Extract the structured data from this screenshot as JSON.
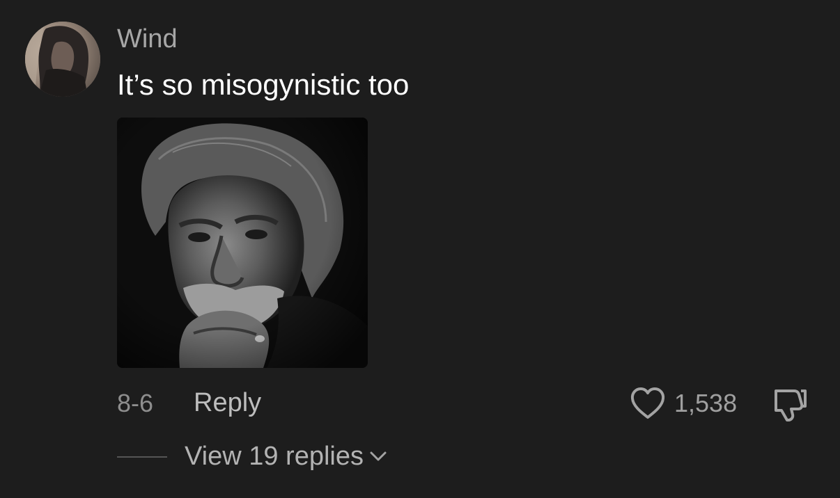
{
  "comment": {
    "avatar_icon": "user-avatar",
    "username": "Wind",
    "text": "It’s so misogynistic too",
    "attached_image": "portrait-photo",
    "timestamp": "8-6",
    "reply_label": "Reply",
    "like_icon": "heart-icon",
    "like_count": "1,538",
    "dislike_icon": "thumbs-down-icon",
    "view_replies_label": "View 19 replies",
    "view_replies_icon": "chevron-down-icon"
  },
  "colors": {
    "background": "#1d1d1d",
    "username": "#a7a7a7",
    "comment_text": "#ffffff",
    "muted": "#8e8e8e"
  }
}
